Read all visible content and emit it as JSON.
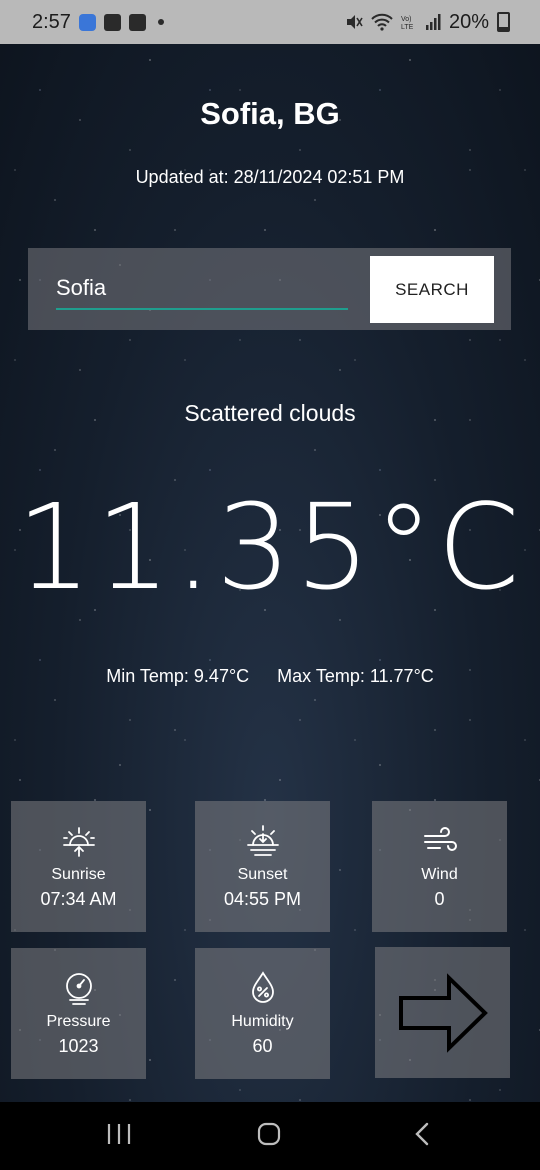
{
  "status_bar": {
    "time": "2:57",
    "battery": "20%"
  },
  "header": {
    "city": "Sofia, BG",
    "updated": "Updated at: 28/11/2024 02:51 PM"
  },
  "search": {
    "value": "Sofia",
    "button_label": "SEARCH"
  },
  "weather": {
    "description": "Scattered clouds",
    "temperature": "11.35°C",
    "min_temp": "Min Temp: 9.47°C",
    "max_temp": "Max Temp: 11.77°C"
  },
  "tiles": [
    {
      "label": "Sunrise",
      "value": "07:34 AM",
      "icon": "sunrise-icon"
    },
    {
      "label": "Sunset",
      "value": "04:55 PM",
      "icon": "sunset-icon"
    },
    {
      "label": "Wind",
      "value": "0",
      "icon": "wind-icon"
    },
    {
      "label": "Pressure",
      "value": "1023",
      "icon": "pressure-gauge-icon"
    },
    {
      "label": "Humidity",
      "value": "60",
      "icon": "humidity-drop-icon"
    },
    {
      "label": "",
      "value": "",
      "icon": "arrow-right-icon"
    }
  ],
  "colors": {
    "status_bar": "#b9b9b9",
    "input_underline": "#1f9e8e",
    "tile_bg": "#7d7d82"
  }
}
